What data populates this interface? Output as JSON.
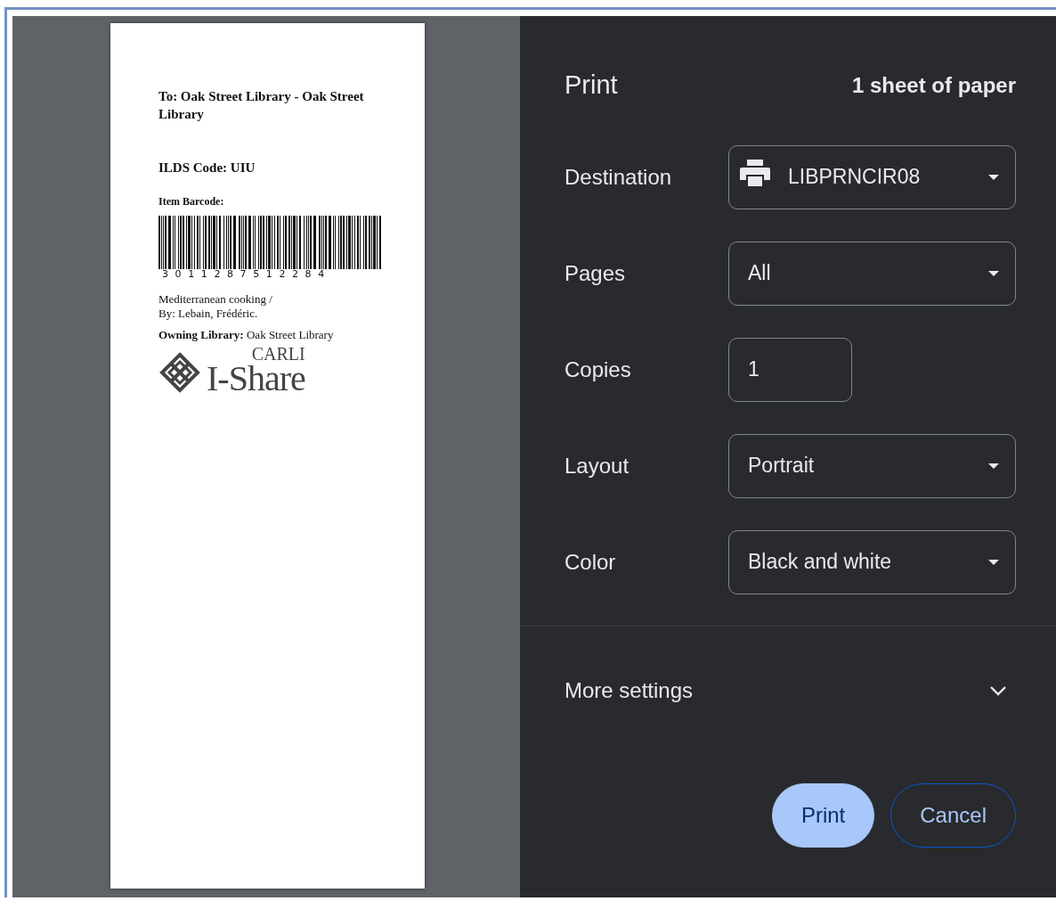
{
  "preview": {
    "to": "To: Oak Street Library - Oak Street Library",
    "ilds": "ILDS Code: UIU",
    "barcode_label": "Item Barcode:",
    "barcode_number": "3011287512284",
    "title": "Mediterranean cooking /",
    "author": "By: Lebain, Frédéric.",
    "owning": "**Owning Library:** Oak Street Library",
    "logo_top": "CARLI",
    "logo_main": "I-Share"
  },
  "header": {
    "title": "Print",
    "sheets": "1 sheet of paper"
  },
  "settings": [
    {
      "label": "Destination",
      "kind": "destination",
      "value": "LIBPRNCIR08"
    },
    {
      "label": "Pages",
      "kind": "select",
      "value": "All"
    },
    {
      "label": "Copies",
      "kind": "number",
      "value": "1"
    },
    {
      "label": "Layout",
      "kind": "select",
      "value": "Portrait"
    },
    {
      "label": "Color",
      "kind": "select",
      "value": "Black and white"
    }
  ],
  "more_settings": {
    "label": "More settings",
    "expanded": false
  },
  "buttons": [
    {
      "label": "Print",
      "kind": "primary"
    },
    {
      "label": "Cancel",
      "kind": "secondary"
    }
  ]
}
